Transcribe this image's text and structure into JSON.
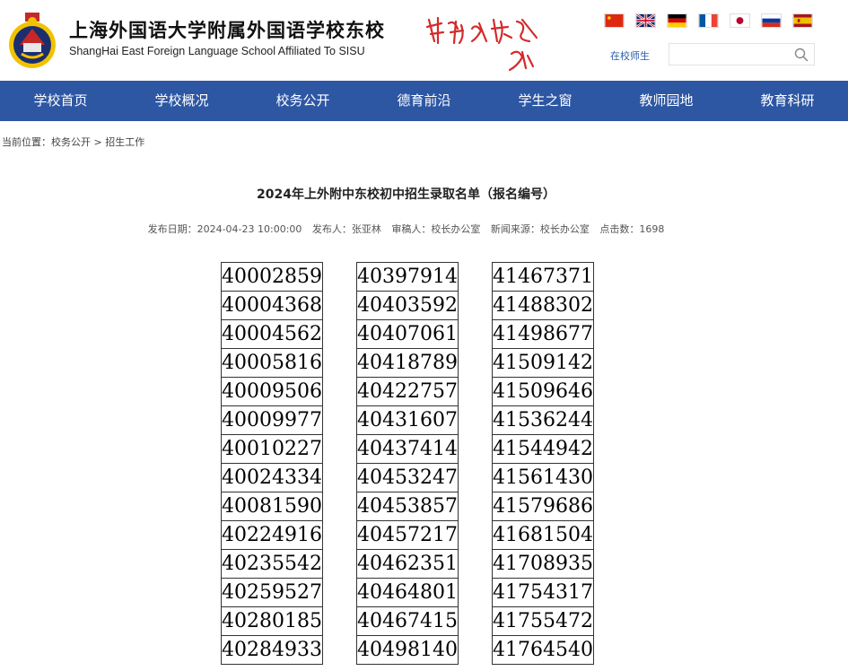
{
  "header": {
    "school_name_cn": "上海外国语大学附属外国语学校东校",
    "school_name_en": "ShangHai East Foreign Language School Affiliated To SISU",
    "staff_link": "在校师生",
    "search_placeholder": "",
    "flags": [
      "china-flag",
      "uk-flag",
      "germany-flag",
      "france-flag",
      "japan-flag",
      "russia-flag",
      "spain-flag"
    ]
  },
  "nav": {
    "items": [
      "学校首页",
      "学校概况",
      "校务公开",
      "德育前沿",
      "学生之窗",
      "教师园地",
      "教育科研"
    ]
  },
  "breadcrumb": {
    "prefix": "当前位置：",
    "level1": "校务公开",
    "separator": " > ",
    "level2": "招生工作"
  },
  "article": {
    "title": "2024年上外附中东校初中招生录取名单（报名编号）",
    "publish_date": "发布日期：2024-04-23 10:00:00",
    "publisher": "发布人：张亚林",
    "reviewer": "审稿人：校长办公室",
    "source": "新闻来源：校长办公室",
    "clicks": "点击数：1698"
  },
  "id_tables": [
    [
      "40002859",
      "40004368",
      "40004562",
      "40005816",
      "40009506",
      "40009977",
      "40010227",
      "40024334",
      "40081590",
      "40224916",
      "40235542",
      "40259527",
      "40280185",
      "40284933"
    ],
    [
      "40397914",
      "40403592",
      "40407061",
      "40418789",
      "40422757",
      "40431607",
      "40437414",
      "40453247",
      "40453857",
      "40457217",
      "40462351",
      "40464801",
      "40467415",
      "40498140"
    ],
    [
      "41467371",
      "41488302",
      "41498677",
      "41509142",
      "41509646",
      "41536244",
      "41544942",
      "41561430",
      "41579686",
      "41681504",
      "41708935",
      "41754317",
      "41755472",
      "41764540"
    ]
  ],
  "colors": {
    "nav_bg": "#2d57a3",
    "motto_red": "#d42a2a"
  }
}
